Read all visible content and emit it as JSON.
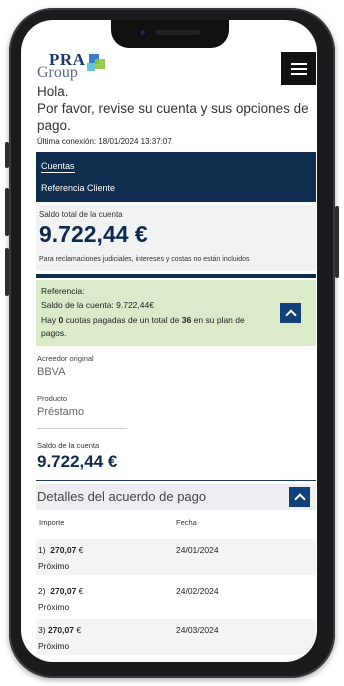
{
  "header": {
    "logo_text_top": "PRA",
    "logo_text_bottom": "Group",
    "menu_icon": "hamburger-menu-icon"
  },
  "greeting": {
    "line1": "Hola.",
    "line2": "Por favor, revise su cuenta y sus opciones de pago."
  },
  "last_connection": "Última conexión: 18/01/2024 13:37:07",
  "nav": {
    "accounts_tab": "Cuentas",
    "client_reference": "Referencia Cliente"
  },
  "total": {
    "label": "Saldo total de la cuenta",
    "amount": "9.722,44 €",
    "note": "Para reclamaciones judiciales, intereses y costas no están incluidos"
  },
  "reference": {
    "title": "Referencia:",
    "balance": "Saldo de la cuenta:  9.722,44€",
    "quotas_pre": "Hay ",
    "quotas_paid": "0",
    "quotas_mid": " cuotas pagadas de un total de ",
    "quotas_total": "36",
    "quotas_post": "  en su plan de pagos.",
    "toggle_icon": "chevron-up-icon"
  },
  "creditor": {
    "label": "Acreedor original",
    "value": "BBVA"
  },
  "product": {
    "label": "Producto",
    "value": "Préstamo"
  },
  "account_balance": {
    "label": "Saldo de la cuenta",
    "amount": "9.722,44 €"
  },
  "plan": {
    "title": "Detalles del acuerdo de pago",
    "toggle_icon": "chevron-up-icon",
    "col_amount": "Importe",
    "col_date": "Fecha",
    "rows": [
      {
        "num": "1)",
        "amount": "270,07",
        "currency": "€",
        "status": "Próximo",
        "date": "24/01/2024"
      },
      {
        "num": "2)",
        "amount": "270,07",
        "currency": "€",
        "status": "Próximo",
        "date": "24/02/2024"
      },
      {
        "num": "3)",
        "amount": "270,07",
        "currency": "€",
        "status": "Próximo",
        "date": "24/03/2024"
      }
    ]
  }
}
